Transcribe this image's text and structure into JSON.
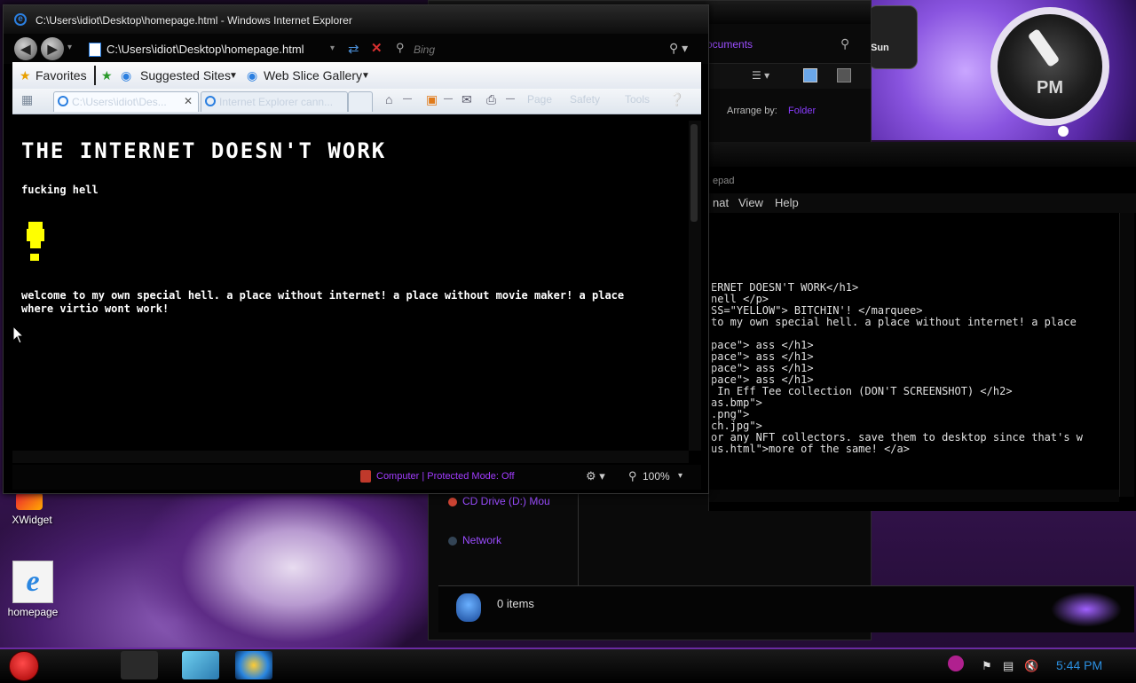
{
  "ie": {
    "title": "C:\\Users\\idiot\\Desktop\\homepage.html - Windows Internet Explorer",
    "url": "C:\\Users\\idiot\\Desktop\\homepage.html",
    "search_placeholder": "Bing",
    "favorites_label": "Favorites",
    "suggested_sites": "Suggested Sites",
    "web_slice_gallery": "Web Slice Gallery",
    "tabs": [
      {
        "label": "C:\\Users\\idiot\\Des..."
      },
      {
        "label": "Internet Explorer cann..."
      }
    ],
    "commands": {
      "page": "Page",
      "safety": "Safety",
      "tools": "Tools"
    },
    "page": {
      "heading": "THE INTERNET DOESN'T WORK",
      "paragraph1": "fucking hell",
      "paragraph2": "welcome to my own special hell. a place without internet! a place without movie maker! a place where virtio wont work!"
    },
    "status": {
      "zone": "Computer | Protected Mode: Off",
      "zoom": "100%"
    }
  },
  "explorer": {
    "breadcrumb": "ocuments",
    "arrange_label": "Arrange by:",
    "arrange_value": "Folder",
    "nav": [
      {
        "label": "CD Drive (D:) Mou"
      },
      {
        "label": "Network"
      }
    ],
    "items_count": "0 items"
  },
  "notepad": {
    "title": "epad",
    "menu": [
      "nat",
      "View",
      "Help"
    ],
    "text_lines": [
      "ERNET DOESN'T WORK</h1>",
      "nell </p>",
      "SS=\"YELLOW\"> BITCHIN'! </marquee>",
      "to my own special hell. a place without internet! a place",
      "",
      "pace\"> ass </h1>",
      "pace\"> ass </h1>",
      "pace\"> ass </h1>",
      "pace\"> ass </h1>",
      " In Eff Tee collection (DON'T SCREENSHOT) </h2>",
      "as.bmp\">",
      ".png\">",
      "ch.jpg\">",
      "or any NFT collectors. save them to desktop since that's w",
      "us.html\">more of the same! </a>"
    ]
  },
  "gadgets": {
    "calendar_day": "Sun",
    "clock_ampm": "PM"
  },
  "desktop": {
    "icons": [
      {
        "label": "XWidget"
      },
      {
        "label": "homepage"
      }
    ]
  },
  "taskbar": {
    "time": "5:44 PM"
  },
  "colors": {
    "accent_purple": "#9b4dff",
    "ie_blue": "#2b7fe0",
    "marquee_yellow": "#ffff00"
  }
}
